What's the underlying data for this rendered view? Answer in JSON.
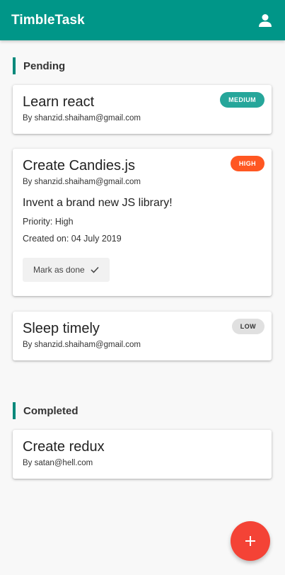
{
  "app": {
    "title": "TimbleTask",
    "user_icon": "account-icon"
  },
  "colors": {
    "primary": "#009688",
    "medium": "#26a69a",
    "high": "#ff5722",
    "low": "#e0e0e0",
    "fab": "#f44336"
  },
  "sections": {
    "pending": {
      "title": "Pending",
      "tasks": [
        {
          "title": "Learn react",
          "author": "By shanzid.shaiham@gmail.com",
          "priority_badge": "MEDIUM"
        },
        {
          "title": "Create Candies.js",
          "author": "By shanzid.shaiham@gmail.com",
          "priority_badge": "HIGH",
          "description": "Invent a brand new JS library!",
          "priority_text": "Priority: High",
          "created_text": "Created on: 04 July 2019",
          "done_label": "Mark as done"
        },
        {
          "title": "Sleep timely",
          "author": "By shanzid.shaiham@gmail.com",
          "priority_badge": "LOW"
        }
      ]
    },
    "completed": {
      "title": "Completed",
      "tasks": [
        {
          "title": "Create redux",
          "author": "By satan@hell.com"
        }
      ]
    }
  },
  "fab": {
    "label": "+",
    "icon": "plus-icon"
  }
}
